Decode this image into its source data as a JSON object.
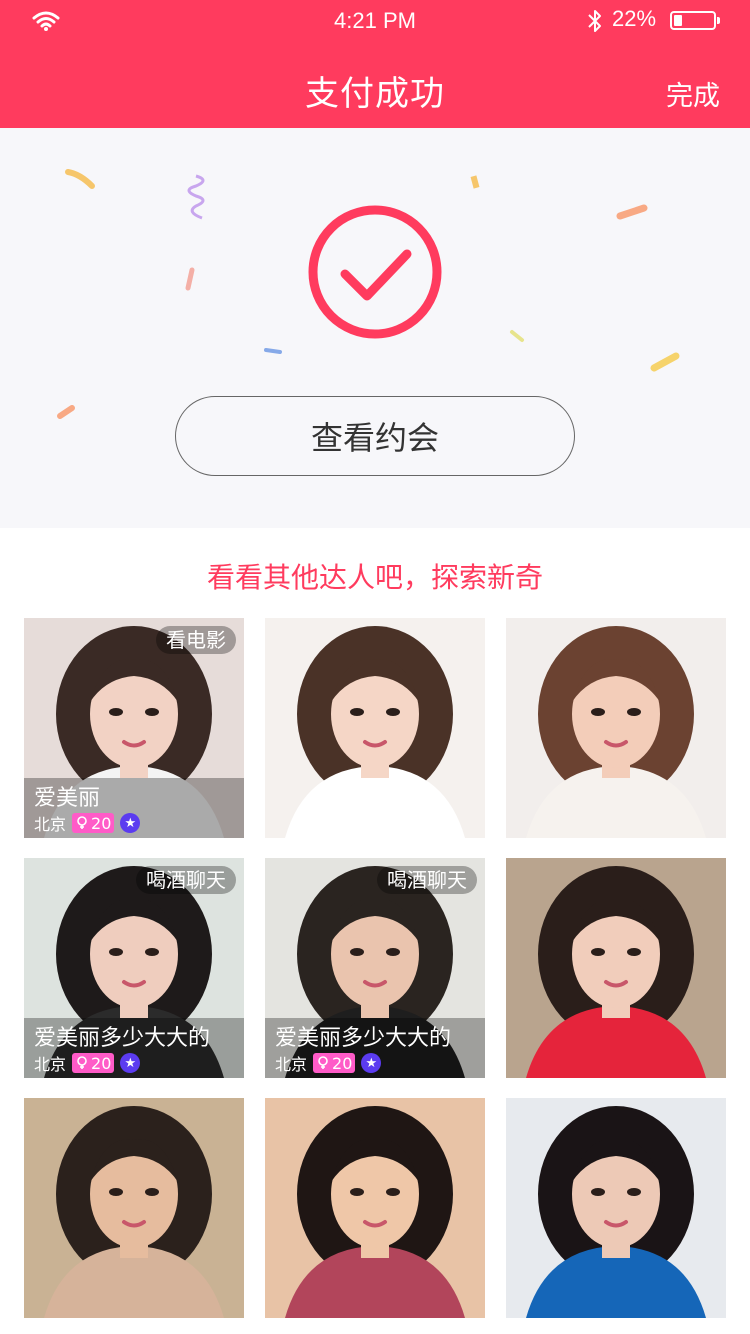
{
  "status_bar": {
    "time": "4:21 PM",
    "battery_percent": "22%",
    "battery_level": 0.22
  },
  "nav": {
    "title": "支付成功",
    "done_label": "完成"
  },
  "success": {
    "button_label": "查看约会"
  },
  "explore": {
    "title": "看看其他达人吧，探索新奇",
    "cards": [
      {
        "tag": "看电影",
        "name": "爱美丽",
        "city": "北京",
        "age": "20",
        "photo": {
          "bg": "#E6DCD9",
          "hair": "#3A2A25",
          "skin": "#F2D2C4",
          "cloth": "#F4F4F4"
        }
      },
      {
        "tag": "",
        "name": "",
        "city": "",
        "age": "",
        "photo": {
          "bg": "#F5F1EE",
          "hair": "#4A3227",
          "skin": "#F5D6C6",
          "cloth": "#FFFFFF"
        }
      },
      {
        "tag": "",
        "name": "",
        "city": "",
        "age": "",
        "photo": {
          "bg": "#F2EEEC",
          "hair": "#6B4231",
          "skin": "#F3CDB9",
          "cloth": "#F6F2EE"
        }
      },
      {
        "tag": "喝酒聊天",
        "name": "爱美丽多少大大的",
        "city": "北京",
        "age": "20",
        "photo": {
          "bg": "#DDE3DF",
          "hair": "#1E1A1A",
          "skin": "#EFCDBE",
          "cloth": "#2B2B2B"
        }
      },
      {
        "tag": "喝酒聊天",
        "name": "爱美丽多少大大的",
        "city": "北京",
        "age": "20",
        "photo": {
          "bg": "#E4E4E0",
          "hair": "#2A2420",
          "skin": "#EAC4AE",
          "cloth": "#1E1E1E"
        }
      },
      {
        "tag": "",
        "name": "",
        "city": "",
        "age": "",
        "photo": {
          "bg": "#B9A48E",
          "hair": "#2A1E1A",
          "skin": "#F1CDBB",
          "cloth": "#E5243B"
        }
      },
      {
        "tag": "",
        "name": "",
        "city": "",
        "age": "",
        "photo": {
          "bg": "#C9B294",
          "hair": "#2B211C",
          "skin": "#E6BC9E",
          "cloth": "#D6B39A"
        }
      },
      {
        "tag": "",
        "name": "",
        "city": "",
        "age": "",
        "photo": {
          "bg": "#E8C3A6",
          "hair": "#1F1614",
          "skin": "#EFC7A8",
          "cloth": "#B2455B"
        }
      },
      {
        "tag": "",
        "name": "",
        "city": "",
        "age": "",
        "photo": {
          "bg": "#E7EAEE",
          "hair": "#1A1416",
          "skin": "#EDC9B6",
          "cloth": "#1566B8"
        }
      }
    ]
  },
  "colors": {
    "brand": "#FF3B5E",
    "button_text": "#333333",
    "button_border": "#666666",
    "age_badge": "#FF5BC8",
    "verified_badge": "#5B3BF0"
  }
}
